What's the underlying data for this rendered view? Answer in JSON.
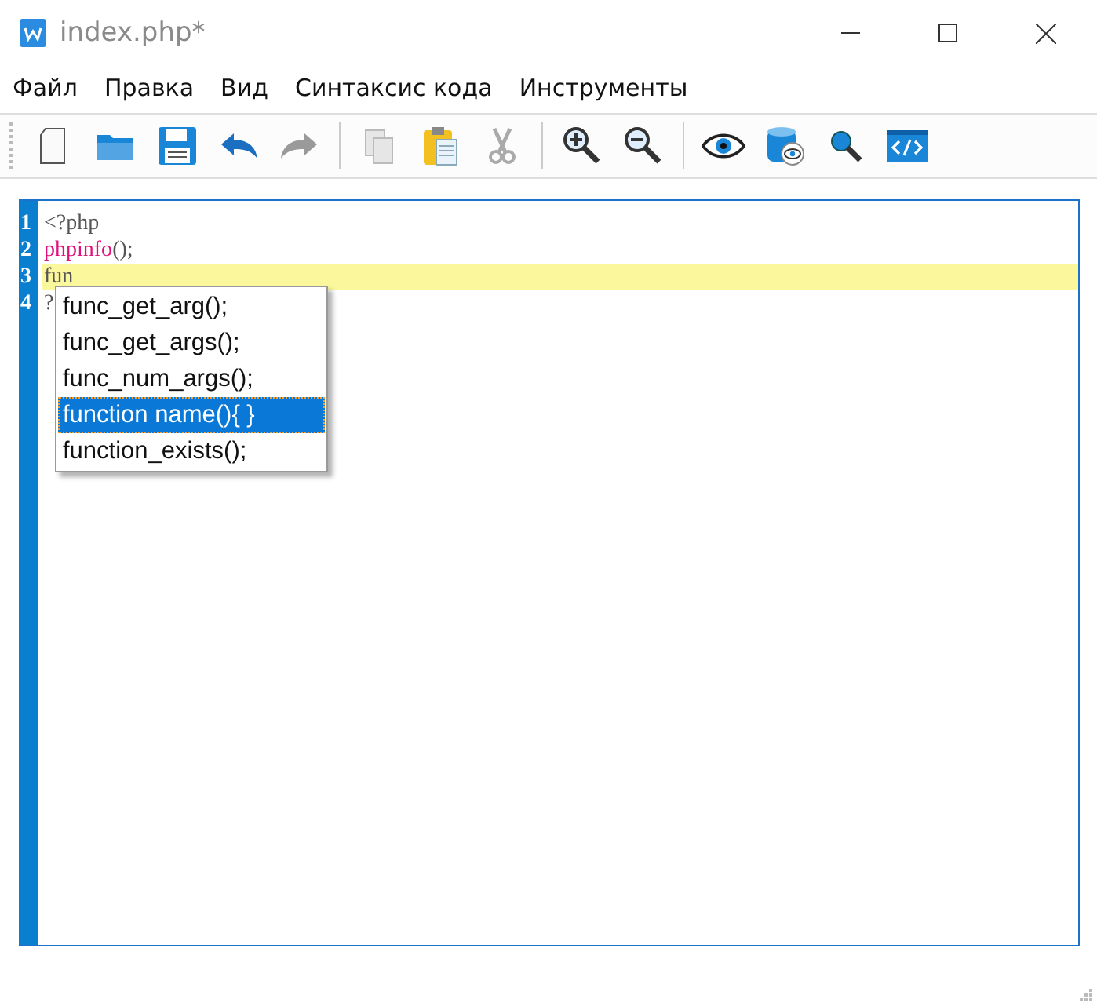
{
  "window": {
    "title": "index.php*"
  },
  "menu": [
    "Файл",
    "Правка",
    "Вид",
    "Синтаксис кода",
    "Инструменты"
  ],
  "toolbar": [
    {
      "kind": "new",
      "disabled": false
    },
    {
      "kind": "open",
      "disabled": false
    },
    {
      "kind": "save",
      "disabled": false
    },
    {
      "kind": "undo",
      "disabled": false
    },
    {
      "kind": "redo",
      "disabled": true
    },
    {
      "kind": "sep"
    },
    {
      "kind": "copy",
      "disabled": true
    },
    {
      "kind": "paste",
      "disabled": false
    },
    {
      "kind": "cut",
      "disabled": true
    },
    {
      "kind": "sep"
    },
    {
      "kind": "zoomin",
      "disabled": false
    },
    {
      "kind": "zoomout",
      "disabled": false
    },
    {
      "kind": "sep"
    },
    {
      "kind": "preview",
      "disabled": false
    },
    {
      "kind": "database",
      "disabled": false
    },
    {
      "kind": "search",
      "disabled": false
    },
    {
      "kind": "code",
      "disabled": false
    }
  ],
  "editor": {
    "lines": [
      {
        "number": "1",
        "current": false,
        "segments": [
          {
            "kind": "plain",
            "text": "<?php"
          }
        ]
      },
      {
        "number": "2",
        "current": false,
        "segments": [
          {
            "kind": "function",
            "text": "phpinfo"
          },
          {
            "kind": "plain",
            "text": "();"
          }
        ]
      },
      {
        "number": "3",
        "current": true,
        "segments": [
          {
            "kind": "plain",
            "text": "fun"
          }
        ]
      },
      {
        "number": "4",
        "current": false,
        "segments": [
          {
            "kind": "plain",
            "text": "?"
          }
        ]
      }
    ]
  },
  "autocomplete": [
    {
      "label": "func_get_arg();",
      "selected": false
    },
    {
      "label": "func_get_args();",
      "selected": false
    },
    {
      "label": "func_num_args();",
      "selected": false
    },
    {
      "label": "function name(){ }",
      "selected": true
    },
    {
      "label": "function_exists();",
      "selected": false
    }
  ]
}
